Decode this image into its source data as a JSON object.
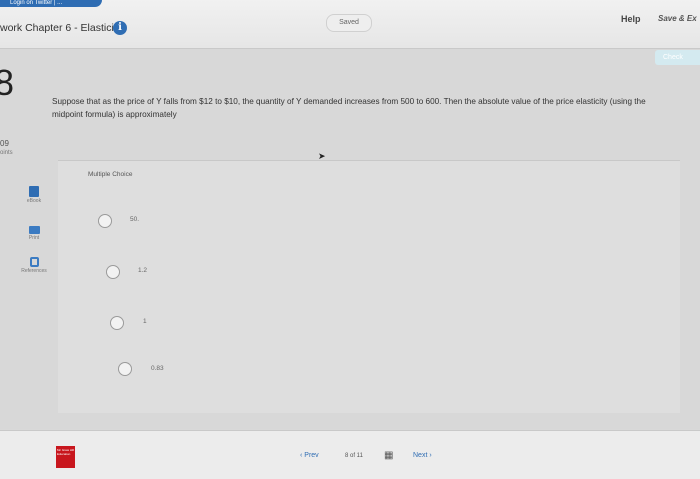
{
  "top_bar": {
    "login_tab": "Login on Twitter | ...",
    "assignment_title": "work Chapter 6 - Elasticity",
    "info_icon": "info-icon",
    "saved_label": "Saved",
    "help_label": "Help",
    "save_exit_label": "Save & Ex",
    "check_label": "Check"
  },
  "question": {
    "number": "8",
    "points_value": "09",
    "points_label": "oints",
    "text": "Suppose that as the price of Y falls from $12 to $10, the quantity of Y demanded increases from 500 to 600. Then the absolute value of the price elasticity (using the midpoint formula) is approximately"
  },
  "tools": [
    {
      "label": "eBook",
      "icon": "ebook-icon"
    },
    {
      "label": "Print",
      "icon": "print-icon"
    },
    {
      "label": "References",
      "icon": "references-icon"
    }
  ],
  "answers": {
    "section_label": "Multiple Choice",
    "options": [
      "50.",
      "1.2",
      "1",
      "0.83"
    ]
  },
  "bottom_bar": {
    "logo_text": "Mc Graw Hill Education",
    "prev_label": "Prev",
    "page_indicator": "8 of 11",
    "grid_icon": "grid-icon",
    "next_label": "Next"
  },
  "colors": {
    "accent": "#2f6db3",
    "logo": "#c8161d"
  }
}
